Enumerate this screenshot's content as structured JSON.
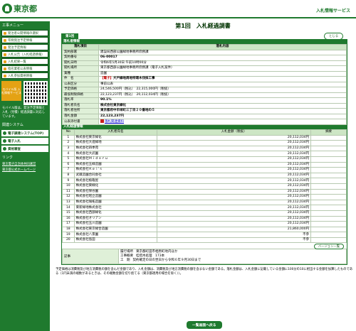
{
  "header": {
    "logo_text": "東京都",
    "service_name": "入札情報サービス"
  },
  "sidebar": {
    "menu_title": "工事メニュー",
    "items": [
      "発注者公開情報の選択",
      "年間発注予定情報",
      "発注予定情報",
      "入札公告（入札経過情報）",
      "入札結果一覧",
      "指名業者公表情報",
      "入札参加資格情報"
    ],
    "mobile_label": "モバイル版 入札情報サービス",
    "mobile_note": "モバイル版は、発注予定情報と入札（見積）経過調書に対応しています。",
    "systems_title": "関連システム",
    "systems": [
      "電子調達システム(TOP)",
      "電子入札",
      "資格審査"
    ],
    "links_title": "リンク",
    "links": [
      "東京電子自治体共同運営",
      "東京都公式ホームページ"
    ]
  },
  "main": {
    "title": "第1回　入札経過調書",
    "tab_label": "第1回",
    "close_button": "とじる",
    "info_section_title": "落札者情報",
    "info_header": {
      "col1": "落札項目",
      "col2": "落札内容"
    },
    "info_rows": [
      {
        "k": "契約部署",
        "v": "建設局西部公園緑地事務所庶務課"
      },
      {
        "k": "契約番号",
        "v": "06-00017"
      },
      {
        "k": "開札日時",
        "v": "令和6年5月30日 午前10時00分"
      },
      {
        "k": "開札場所",
        "v": "東京都西部公園緑地事務所庶務課（電子入札案件）"
      },
      {
        "k": "業種",
        "v": "造園"
      },
      {
        "k": "件　名",
        "v_tag": "【電子】",
        "v": "大戸緑地周地特環木伐採工事"
      },
      {
        "k": "公表区分",
        "v": "事前公表"
      },
      {
        "k": "予定価格",
        "v": "24,546,500円（税込）　22,315,000円（税抜）"
      },
      {
        "k": "最低制限価格",
        "v": "22,123,237円（税込）　20,112,034円（税抜）"
      },
      {
        "k": "落札率",
        "v": "90.1%"
      },
      {
        "k": "落札者氏名",
        "v": "株式会社東京緑化"
      },
      {
        "k": "落札者住所",
        "v": "東京都府中市栄町三丁目２０番地の５"
      },
      {
        "k": "落札金額",
        "v": "22,123,237円"
      },
      {
        "k": "公表添付書",
        "v": "落札関連資料"
      }
    ],
    "ranking_section_title": "入札経過情報",
    "ranking_header": {
      "no": "No",
      "name": "入札者氏名",
      "amount": "入札金額（税抜）",
      "note": "摘要"
    },
    "ranking_rows": [
      {
        "no": "1",
        "name": "株式会社東京緑化",
        "amount": "20,112,034円",
        "note": ""
      },
      {
        "no": "2",
        "name": "株式会社大進緑地",
        "amount": "20,112,034円",
        "note": ""
      },
      {
        "no": "3",
        "name": "株式会社四季苑",
        "amount": "20,112,034円",
        "note": ""
      },
      {
        "no": "4",
        "name": "株式会社大武園",
        "amount": "20,112,034円",
        "note": ""
      },
      {
        "no": "5",
        "name": "株式会社Ｍｉｄｏｒｕ",
        "amount": "20,112,034円",
        "note": ""
      },
      {
        "no": "6",
        "name": "株式会社玉緑造園",
        "amount": "20,112,034円",
        "note": ""
      },
      {
        "no": "7",
        "name": "株式会社Ｋｅｉ'ｓ",
        "amount": "20,112,034円",
        "note": ""
      },
      {
        "no": "8",
        "name": "武蔵造園合同会社",
        "amount": "20,112,034円",
        "note": ""
      },
      {
        "no": "9",
        "name": "株式会社植栽屋",
        "amount": "20,112,034円",
        "note": ""
      },
      {
        "no": "10",
        "name": "株式会社東緑化",
        "amount": "20,112,034円",
        "note": ""
      },
      {
        "no": "11",
        "name": "株式会社保谷園",
        "amount": "20,112,034円",
        "note": ""
      },
      {
        "no": "12",
        "name": "株式会社昭立造園",
        "amount": "20,112,034円",
        "note": ""
      },
      {
        "no": "13",
        "name": "株式会社報拓造園",
        "amount": "20,112,034円",
        "note": ""
      },
      {
        "no": "14",
        "name": "東新緑地株式会社",
        "amount": "20,112,034円",
        "note": ""
      },
      {
        "no": "15",
        "name": "株式会社西部緑化",
        "amount": "20,112,034円",
        "note": ""
      },
      {
        "no": "16",
        "name": "株式会社オリアン",
        "amount": "20,112,034円",
        "note": ""
      },
      {
        "no": "17",
        "name": "株式会社玉川造園",
        "amount": "20,112,034円",
        "note": ""
      },
      {
        "no": "18",
        "name": "株式会社東京緑合造園",
        "amount": "21,860,000円",
        "note": ""
      },
      {
        "no": "19",
        "name": "株式会社八景園",
        "amount": "不参",
        "note": ""
      },
      {
        "no": "20",
        "name": "株式会社島田",
        "amount": "不参",
        "note": ""
      }
    ],
    "history_button": "バージョン一覧",
    "remarks_label": "記事",
    "remarks": [
      {
        "k": "履行場所",
        "v": "東京都町田市相原町地内ほか"
      },
      {
        "k": "工事概要",
        "v": "桂措木処理　173本"
      },
      {
        "k": "工　期",
        "v": "契約確定の日の翌日から令和６年９月30日まで"
      }
    ],
    "footnote": "予定価格は消費税及び地方消費税の額を含んだ金額であり、入札金額は、消費税及び地方消費税の額を含まない金額である。落札金額は、入札金額に記載している金額に100分の10に相当する金額を加算したものである（1円未満の端数があるときは、その端数金額を切り捨てる（東京都適用の場合を除く））。",
    "back_button": "一覧画面へ戻る"
  }
}
